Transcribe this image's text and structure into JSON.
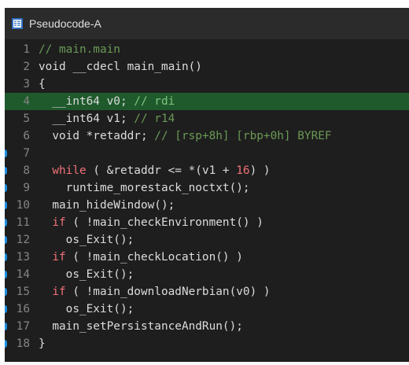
{
  "window": {
    "tab_title": "Pseudocode-A",
    "tab_icon": "pseudocode-document-icon"
  },
  "code": {
    "current_line": 4,
    "breakpoint_lines": [
      7,
      8,
      9,
      10,
      11,
      12,
      13,
      14,
      15,
      16,
      17,
      18
    ],
    "lines": [
      {
        "n": "1",
        "segs": [
          [
            "cm",
            "// main.main"
          ]
        ]
      },
      {
        "n": "2",
        "segs": [
          [
            "plain",
            "void __cdecl main_main()"
          ]
        ]
      },
      {
        "n": "3",
        "segs": [
          [
            "plain",
            "{"
          ]
        ]
      },
      {
        "n": "4",
        "segs": [
          [
            "plain",
            "  __int64 v0; "
          ],
          [
            "cm-bright",
            "// rdi"
          ]
        ]
      },
      {
        "n": "5",
        "segs": [
          [
            "plain",
            "  __int64 v1; "
          ],
          [
            "cm",
            "// r14"
          ]
        ]
      },
      {
        "n": "6",
        "segs": [
          [
            "plain",
            "  void *retaddr; "
          ],
          [
            "cm",
            "// [rsp+8h] [rbp+0h] BYREF"
          ]
        ]
      },
      {
        "n": "7",
        "segs": [
          [
            "plain",
            ""
          ]
        ]
      },
      {
        "n": "8",
        "segs": [
          [
            "kw",
            "  while"
          ],
          [
            "plain",
            " ( &retaddr <= *(v1 + "
          ],
          [
            "num",
            "16"
          ],
          [
            "plain",
            ") )"
          ]
        ]
      },
      {
        "n": "9",
        "segs": [
          [
            "plain",
            "    runtime_morestack_noctxt();"
          ]
        ]
      },
      {
        "n": "10",
        "segs": [
          [
            "plain",
            "  main_hideWindow();"
          ]
        ]
      },
      {
        "n": "11",
        "segs": [
          [
            "kw",
            "  if"
          ],
          [
            "plain",
            " ( !main_checkEnvironment() )"
          ]
        ]
      },
      {
        "n": "12",
        "segs": [
          [
            "plain",
            "    os_Exit();"
          ]
        ]
      },
      {
        "n": "13",
        "segs": [
          [
            "kw",
            "  if"
          ],
          [
            "plain",
            " ( !main_checkLocation() )"
          ]
        ]
      },
      {
        "n": "14",
        "segs": [
          [
            "plain",
            "    os_Exit();"
          ]
        ]
      },
      {
        "n": "15",
        "segs": [
          [
            "kw",
            "  if"
          ],
          [
            "plain",
            " ( !main_downloadNerbian(v0) )"
          ]
        ]
      },
      {
        "n": "16",
        "segs": [
          [
            "plain",
            "    os_Exit();"
          ]
        ]
      },
      {
        "n": "17",
        "segs": [
          [
            "plain",
            "  main_setPersistanceAndRun();"
          ]
        ]
      },
      {
        "n": "18",
        "segs": [
          [
            "plain",
            "}"
          ]
        ]
      }
    ]
  },
  "colors": {
    "editor_bg": "#1e1e1e",
    "current_line_bg": "#1f5a2c",
    "keyword": "#f07178",
    "comment": "#6a9955",
    "line_number": "#858585",
    "breakpoint_marker": "#1e8fe0"
  }
}
